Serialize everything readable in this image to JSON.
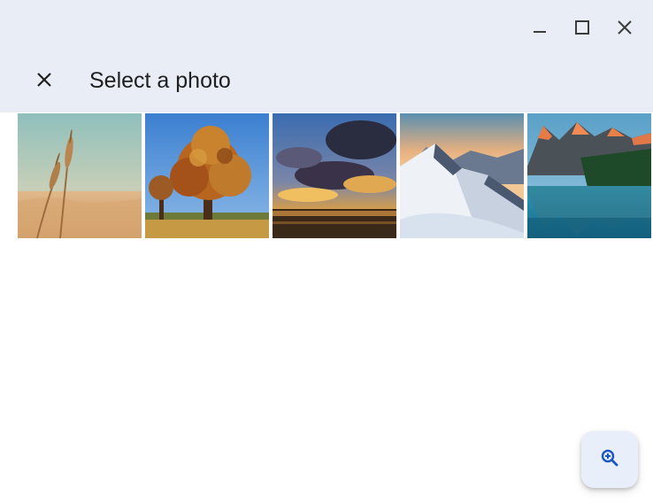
{
  "window": {
    "controls": {
      "minimize_icon": "minimize-icon",
      "maximize_icon": "maximize-icon",
      "close_icon": "close-icon"
    }
  },
  "header": {
    "close_icon": "close-icon",
    "title": "Select a photo",
    "background": "#e8edf6"
  },
  "gallery": {
    "photos": [
      {
        "subject": "wheat"
      },
      {
        "subject": "autumn-tree"
      },
      {
        "subject": "sunset-clouds"
      },
      {
        "subject": "snowy-mountains"
      },
      {
        "subject": "mountain-lake"
      }
    ]
  },
  "fab": {
    "icon": "zoom-in-icon",
    "accent": "#1a56c4"
  }
}
